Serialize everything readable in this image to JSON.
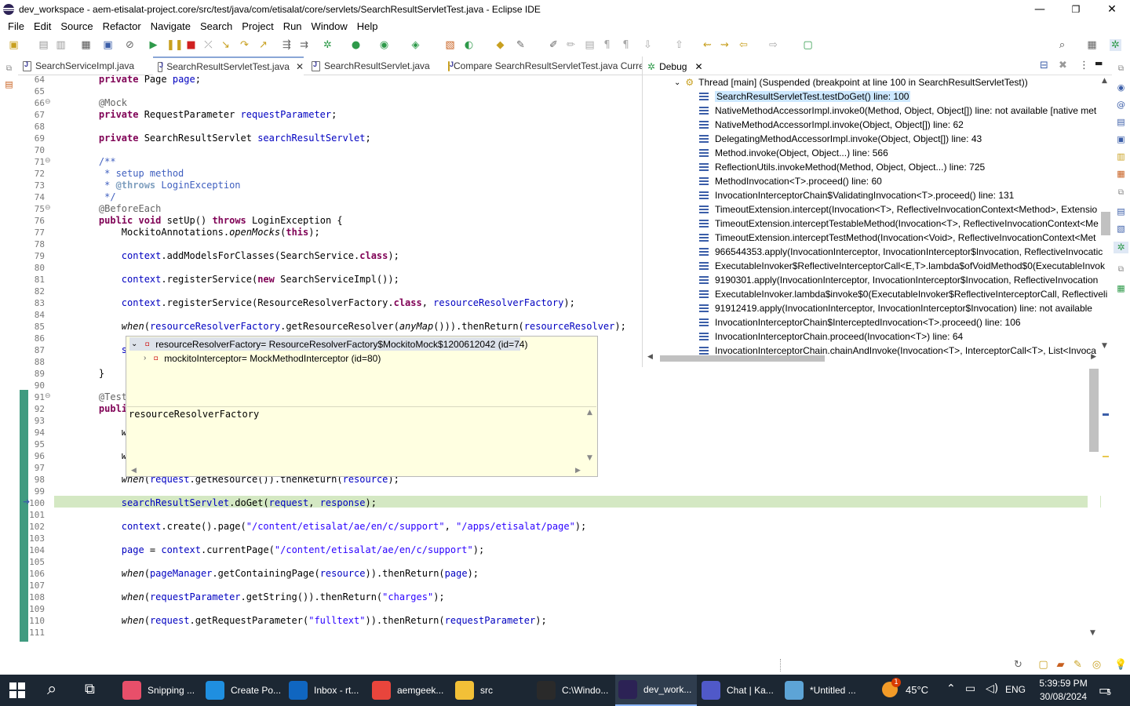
{
  "window": {
    "title": "dev_workspace - aem-etisalat-project.core/src/test/java/com/etisalat/core/servlets/SearchResultServletTest.java - Eclipse IDE",
    "minimize": "—",
    "maximize": "❐",
    "close": "✕"
  },
  "menu": [
    "File",
    "Edit",
    "Source",
    "Refactor",
    "Navigate",
    "Search",
    "Project",
    "Run",
    "Window",
    "Help"
  ],
  "editor": {
    "tabs": [
      {
        "label": "SearchServiceImpl.java"
      },
      {
        "label": "SearchResultServletTest.java",
        "close": "✕"
      },
      {
        "label": "SearchResultServlet.java"
      },
      {
        "label": "Compare SearchResultServletTest.java Curre"
      }
    ],
    "lines": [
      {
        "n": "64",
        "html": "    <span class='kw'>private</span> Page <span class='fld'>page</span>;"
      },
      {
        "n": "65",
        "html": ""
      },
      {
        "n": "66",
        "html": "    <span class='an'>@Mock</span>"
      },
      {
        "n": "67",
        "html": "    <span class='kw'>private</span> RequestParameter <span class='fld'>requestParameter</span>;"
      },
      {
        "n": "68",
        "html": ""
      },
      {
        "n": "69",
        "html": "    <span class='kw'>private</span> SearchResultServlet <span class='fld'>searchResultServlet</span>;"
      },
      {
        "n": "70",
        "html": ""
      },
      {
        "n": "71",
        "html": "    <span class='cm'>/**</span>"
      },
      {
        "n": "72",
        "html": "<span class='cm'>     * setup method</span>"
      },
      {
        "n": "73",
        "html": "<span class='cm'>     * <span style='color:#7f9fbf;font-weight:bold'>@throws</span> LoginException</span>"
      },
      {
        "n": "74",
        "html": "<span class='cm'>     */</span>"
      },
      {
        "n": "75",
        "html": "    <span class='an'>@BeforeEach</span>"
      },
      {
        "n": "76",
        "html": "    <span class='kw'>public</span> <span class='kw'>void</span> setUp() <span class='kw'>throws</span> LoginException {"
      },
      {
        "n": "77",
        "html": "        MockitoAnnotations.<span class='it'>openMocks</span>(<span class='kw'>this</span>);"
      },
      {
        "n": "78",
        "html": ""
      },
      {
        "n": "79",
        "html": "        <span class='fld'>context</span>.addModelsForClasses(SearchService.<span class='kw'>class</span>);"
      },
      {
        "n": "80",
        "html": ""
      },
      {
        "n": "81",
        "html": "        <span class='fld'>context</span>.registerService(<span class='kw'>new</span> SearchServiceImpl());"
      },
      {
        "n": "82",
        "html": ""
      },
      {
        "n": "83",
        "html": "        <span class='fld'>context</span>.registerService(ResourceResolverFactory.<span class='kw'>class</span>, <span class='fld'>resourceResolverFactory</span>);"
      },
      {
        "n": "84",
        "html": ""
      },
      {
        "n": "85",
        "html": "        <span class='it'>when</span>(<span class='fld'>resourceResolverFactory</span>.getResourceResolver(<span class='it'>anyMap</span>())).thenReturn(<span class='fld'>resourceResolver</span>);"
      },
      {
        "n": "86",
        "html": ""
      },
      {
        "n": "87",
        "html": "        <span class='fld'>searc</span>"
      },
      {
        "n": "88",
        "html": ""
      },
      {
        "n": "89",
        "html": "    }"
      },
      {
        "n": "90",
        "html": ""
      },
      {
        "n": "91",
        "html": "    <span class='an'>@Test</span>"
      },
      {
        "n": "92",
        "html": "    <span class='kw'>public</span> <span class='kw'>vo</span>"
      },
      {
        "n": "93",
        "html": ""
      },
      {
        "n": "94",
        "html": "        <span class='it'>when</span>("
      },
      {
        "n": "95",
        "html": ""
      },
      {
        "n": "96",
        "html": "        <span class='it'>when</span>("
      },
      {
        "n": "97",
        "html": ""
      },
      {
        "n": "98",
        "html": "        <span class='it'>when</span>(<span class='fld'>request</span>.getResource()).thenReturn(<span class='fld'>resource</span>);"
      },
      {
        "n": "99",
        "html": ""
      },
      {
        "n": "100",
        "html": "        <span class='fld'>searchResultServlet</span>.doGet(<span class='fld'>request</span>, <span class='fld'>response</span>);"
      },
      {
        "n": "101",
        "html": ""
      },
      {
        "n": "102",
        "html": "        <span class='fld'>context</span>.create().page(<span class='str'>\"/content/etisalat/ae/en/c/support\"</span>, <span class='str'>\"/apps/etisalat/page\"</span>);"
      },
      {
        "n": "103",
        "html": ""
      },
      {
        "n": "104",
        "html": "        <span class='fld'>page</span> = <span class='fld'>context</span>.currentPage(<span class='str'>\"/content/etisalat/ae/en/c/support\"</span>);"
      },
      {
        "n": "105",
        "html": ""
      },
      {
        "n": "106",
        "html": "        <span class='it'>when</span>(<span class='fld'>pageManager</span>.getContainingPage(<span class='fld'>resource</span>)).thenReturn(<span class='fld'>page</span>);"
      },
      {
        "n": "107",
        "html": ""
      },
      {
        "n": "108",
        "html": "        <span class='it'>when</span>(<span class='fld'>requestParameter</span>.getString()).thenReturn(<span class='str'>\"charges\"</span>);"
      },
      {
        "n": "109",
        "html": ""
      },
      {
        "n": "110",
        "html": "        <span class='it'>when</span>(<span class='fld'>request</span>.getRequestParameter(<span class='str'>\"fulltext\"</span>)).thenReturn(<span class='fld'>requestParameter</span>);"
      },
      {
        "n": "111",
        "html": ""
      }
    ]
  },
  "debug": {
    "tab_label": "Debug",
    "thread": "Thread [main] (Suspended (breakpoint at line 100 in SearchResultServletTest))",
    "frames": [
      "SearchResultServletTest.testDoGet() line: 100",
      "NativeMethodAccessorImpl.invoke0(Method, Object, Object[]) line: not available [native met",
      "NativeMethodAccessorImpl.invoke(Object, Object[]) line: 62",
      "DelegatingMethodAccessorImpl.invoke(Object, Object[]) line: 43",
      "Method.invoke(Object, Object...) line: 566",
      "ReflectionUtils.invokeMethod(Method, Object, Object...) line: 725",
      "MethodInvocation<T>.proceed() line: 60",
      "InvocationInterceptorChain$ValidatingInvocation<T>.proceed() line: 131",
      "TimeoutExtension.intercept(Invocation<T>, ReflectiveInvocationContext<Method>, Extensio",
      "TimeoutExtension.interceptTestableMethod(Invocation<T>, ReflectiveInvocationContext<Me",
      "TimeoutExtension.interceptTestMethod(Invocation<Void>, ReflectiveInvocationContext<Met",
      "966544353.apply(InvocationInterceptor, InvocationInterceptor$Invocation, ReflectiveInvocatic",
      "ExecutableInvoker$ReflectiveInterceptorCall<E,T>.lambda$ofVoidMethod$0(ExecutableInvok",
      "9190301.apply(InvocationInterceptor, InvocationInterceptor$Invocation, ReflectiveInvocation",
      "ExecutableInvoker.lambda$invoke$0(ExecutableInvoker$ReflectiveInterceptorCall, Reflectiveli",
      "91912419.apply(InvocationInterceptor, InvocationInterceptor$Invocation) line: not available",
      "InvocationInterceptorChain$InterceptedInvocation<T>.proceed() line: 106",
      "InvocationInterceptorChain.proceed(Invocation<T>) line: 64",
      "InvocationInterceptorChain.chainAndInvoke(Invocation<T>, InterceptorCall<T>, List<Invoca"
    ]
  },
  "hover_popup": {
    "root": "resourceResolverFactory= ResourceResolverFactory$MockitoMock$1200612042  (id=74)",
    "child": "mockitoInterceptor= MockMethodInterceptor  (id=80)",
    "detail": "resourceResolverFactory"
  },
  "taskbar": {
    "apps": [
      {
        "label": "Snipping ...",
        "color": "#e84f6a"
      },
      {
        "label": "Create Po...",
        "color": "#1f8fe0"
      },
      {
        "label": "Inbox - rt...",
        "color": "#1066c0"
      },
      {
        "label": "aemgeek...",
        "color": "#e8453c"
      },
      {
        "label": "src",
        "color": "#f2c037"
      },
      {
        "label": "C:\\Windo...",
        "color": "#2a2a2a"
      },
      {
        "label": "dev_work...",
        "color": "#2c2255"
      },
      {
        "label": "Chat | Ka...",
        "color": "#5059c9"
      },
      {
        "label": "*Untitled ...",
        "color": "#5da4d6"
      }
    ],
    "weather": "45°C",
    "weather_badge": "1",
    "language": "ENG",
    "time": "5:39:59 PM",
    "date": "30/08/2024",
    "notification_count": "5"
  }
}
